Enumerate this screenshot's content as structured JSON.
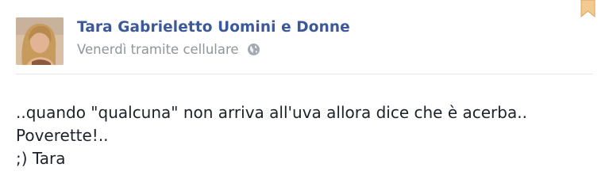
{
  "post": {
    "author": "Tara Gabrieletto Uomini e Donne",
    "meta_text": "Venerdì tramite cellulare",
    "message_lines": [
      "..quando \"qualcuna\" non arriva all'uva allora dice che è acerba..",
      "Poverette!..",
      ";) Tara"
    ],
    "icons": {
      "audience": "globe-icon",
      "bookmark": "bookmark-icon"
    },
    "colors": {
      "author_link": "#3b5998",
      "meta_text": "#90949c",
      "message_text": "#1d2129",
      "bookmark": "#f0c080"
    }
  }
}
